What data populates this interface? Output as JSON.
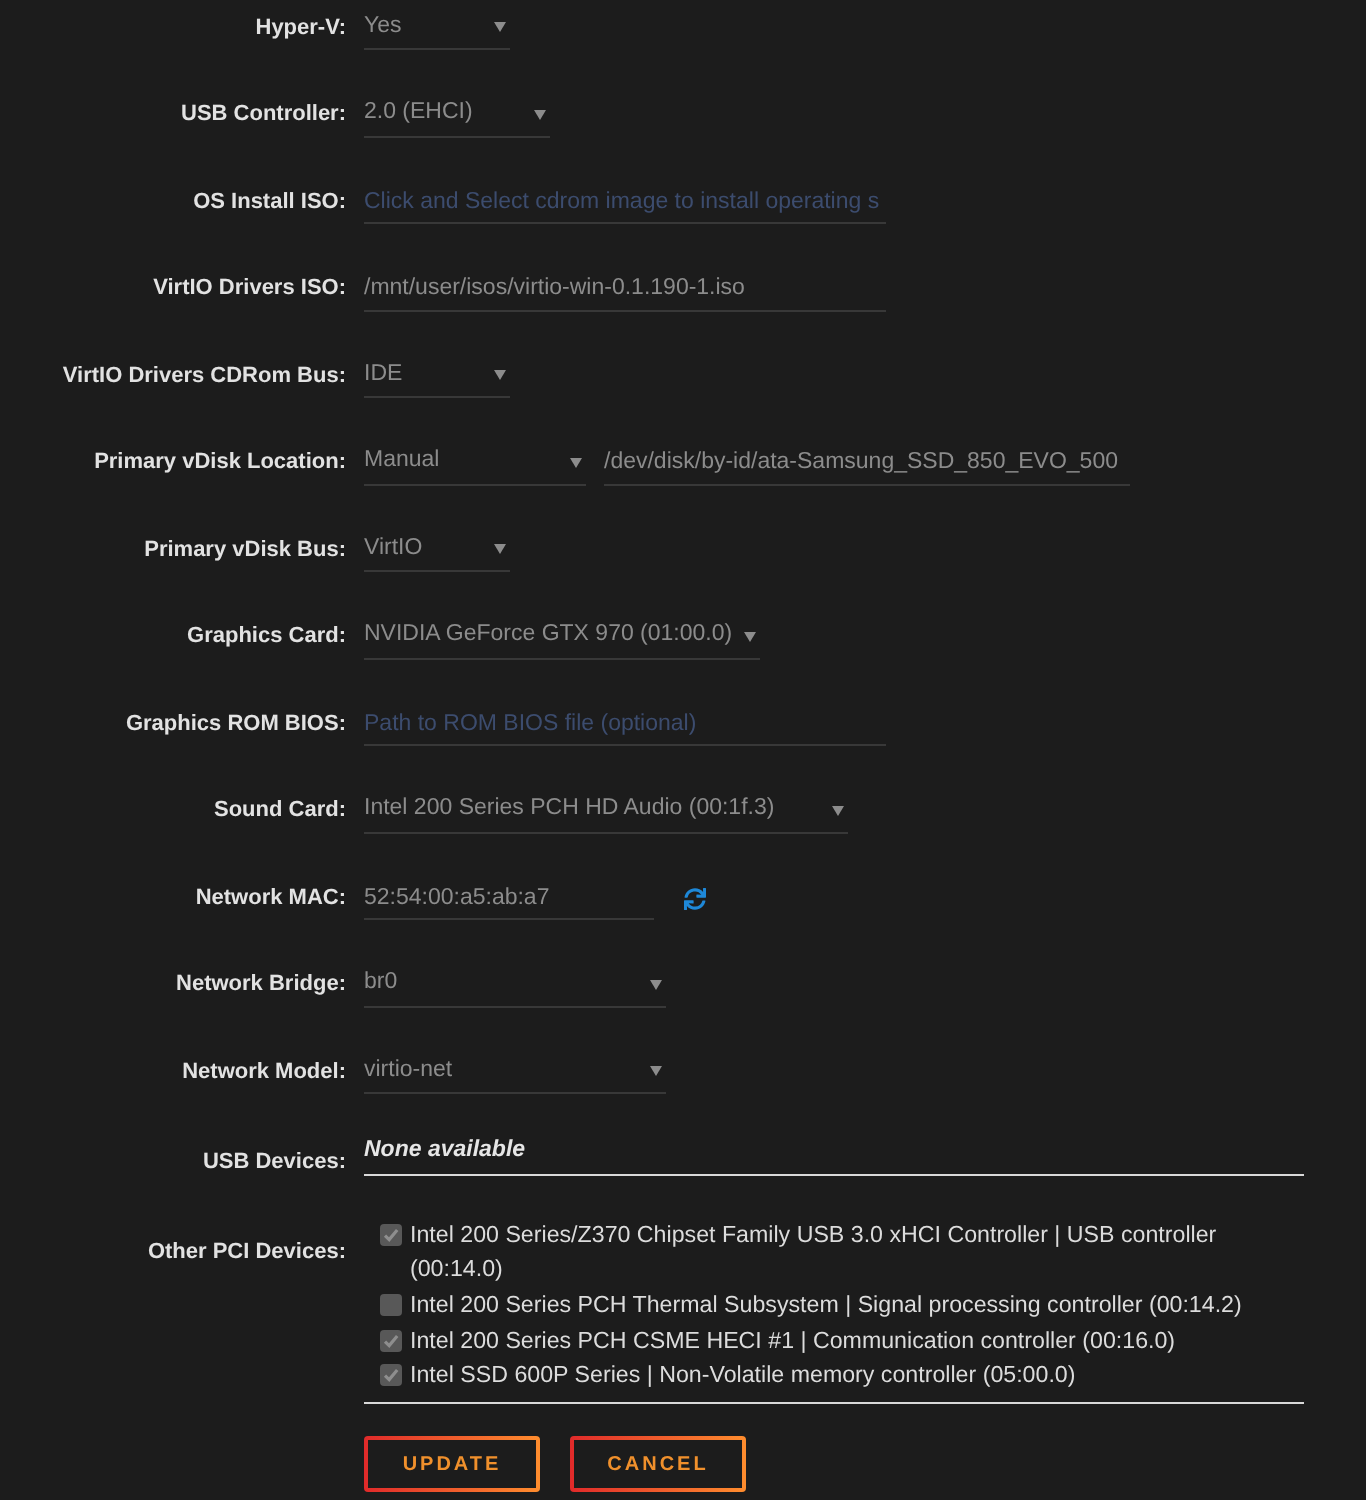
{
  "form": {
    "fields": [
      {
        "kind": "select",
        "label": "Hyper-V:",
        "value": "Yes"
      },
      {
        "kind": "select",
        "label": "USB Controller:",
        "value": "2.0 (EHCI)"
      },
      {
        "kind": "input",
        "label": "OS Install ISO:",
        "placeholder": "Click and Select cdrom image to install operating s"
      },
      {
        "kind": "input",
        "label": "VirtIO Drivers ISO:",
        "value": "/mnt/user/isos/virtio-win-0.1.190-1.iso"
      },
      {
        "kind": "select",
        "label": "VirtIO Drivers CDRom Bus:",
        "value": "IDE"
      },
      {
        "kind": "select_input",
        "label": "Primary vDisk Location:",
        "value": "Manual",
        "path": "/dev/disk/by-id/ata-Samsung_SSD_850_EVO_500"
      },
      {
        "kind": "select",
        "label": "Primary vDisk Bus:",
        "value": "VirtIO"
      },
      {
        "kind": "select",
        "label": "Graphics Card:",
        "value": "NVIDIA GeForce GTX 970 (01:00.0)"
      },
      {
        "kind": "input",
        "label": "Graphics ROM BIOS:",
        "placeholder": "Path to ROM BIOS file (optional)"
      },
      {
        "kind": "select",
        "label": "Sound Card:",
        "value": "Intel 200 Series PCH HD Audio (00:1f.3)"
      },
      {
        "kind": "input_refresh",
        "label": "Network MAC:",
        "value": "52:54:00:a5:ab:a7"
      },
      {
        "kind": "select",
        "label": "Network Bridge:",
        "value": "br0"
      },
      {
        "kind": "select",
        "label": "Network Model:",
        "value": "virtio-net"
      }
    ],
    "usb_devices": {
      "label": "USB Devices:",
      "value": "None available"
    },
    "pci_devices": {
      "label": "Other PCI Devices:",
      "items": [
        {
          "label": "Intel 200 Series/Z370 Chipset Family USB 3.0 xHCI Controller | USB controller (00:14.0)",
          "checked": true
        },
        {
          "label": "Intel 200 Series PCH Thermal Subsystem | Signal processing controller (00:14.2)",
          "checked": false
        },
        {
          "label": "Intel 200 Series PCH CSME HECI #1 | Communication controller (00:16.0)",
          "checked": true
        },
        {
          "label": "Intel SSD 600P Series | Non-Volatile memory controller (05:00.0)",
          "checked": true
        }
      ]
    },
    "buttons": [
      {
        "label": "UPDATE"
      },
      {
        "label": "CANCEL"
      }
    ]
  }
}
